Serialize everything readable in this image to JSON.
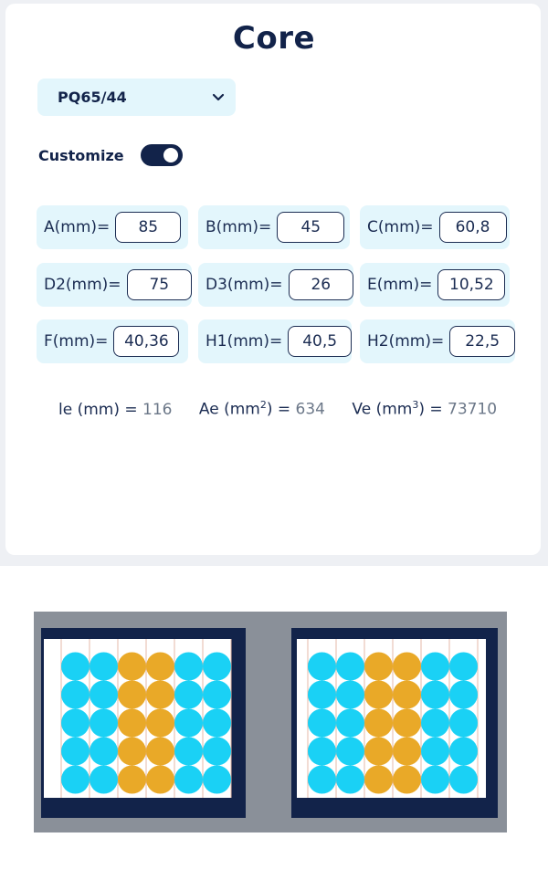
{
  "header": {
    "title": "Core"
  },
  "core_select": {
    "value": "PQ65/44",
    "icon": "chevron-down-icon"
  },
  "customize": {
    "label": "Customize",
    "enabled": true
  },
  "dims": [
    {
      "key": "A(mm)=",
      "value": "85"
    },
    {
      "key": "B(mm)=",
      "value": "45"
    },
    {
      "key": "C(mm)=",
      "value": "60,8"
    },
    {
      "key": "D2(mm)=",
      "value": "75"
    },
    {
      "key": "D3(mm)=",
      "value": "26"
    },
    {
      "key": "E(mm)=",
      "value": "10,52"
    },
    {
      "key": "F(mm)=",
      "value": "40,36"
    },
    {
      "key": "H1(mm)=",
      "value": "40,5"
    },
    {
      "key": "H2(mm)=",
      "value": "22,5"
    }
  ],
  "metrics": {
    "le_label": "le (mm) =",
    "le_value": "116",
    "ae_label_pre": "Ae (mm",
    "ae_sup": "2",
    "ae_label_post": ") =",
    "ae_value": "634",
    "ve_label_pre": "Ve (mm",
    "ve_sup": "3",
    "ve_label_post": ") =",
    "ve_value": "73710"
  },
  "colors": {
    "navy": "#12234a",
    "cell_bg": "#e3f6fc",
    "core_gray": "#8a9099",
    "winding_cyan": "#1ad1f5",
    "winding_orange": "#e9a928"
  }
}
